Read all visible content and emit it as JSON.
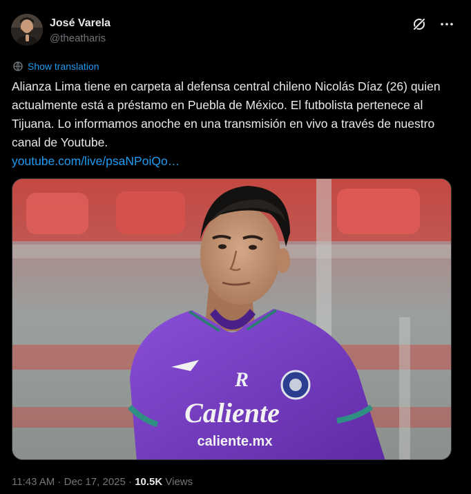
{
  "author": {
    "display_name": "José Varela",
    "handle": "@theatharis"
  },
  "icons": {
    "grok": "grok-icon",
    "more": "more-icon",
    "translate": "globe-icon"
  },
  "translation": {
    "label": "Show translation"
  },
  "tweet": {
    "text": "Alianza Lima tiene en carpeta al defensa central chileno Nicolás Díaz (26) quien actualmente está a préstamo en Puebla de México. El futbolista pertenece al Tijuana. Lo informamos anoche en una transmisión en vivo a través de nuestro canal de Youtube.",
    "link": "youtube.com/live/psaNPoiQo…"
  },
  "media": {
    "jersey_sponsor": "Caliente",
    "jersey_sponsor_url": "caliente.mx",
    "crest_letter": "R"
  },
  "meta": {
    "time": "11:43 AM",
    "separator": " · ",
    "date": "Dec 17, 2025",
    "views_count": "10.5K",
    "views_label": " Views"
  },
  "colors": {
    "background": "#000000",
    "text": "#e7e9ea",
    "secondary": "#71767b",
    "link": "#1d9bf0",
    "jersey": "#7b3fc4"
  }
}
